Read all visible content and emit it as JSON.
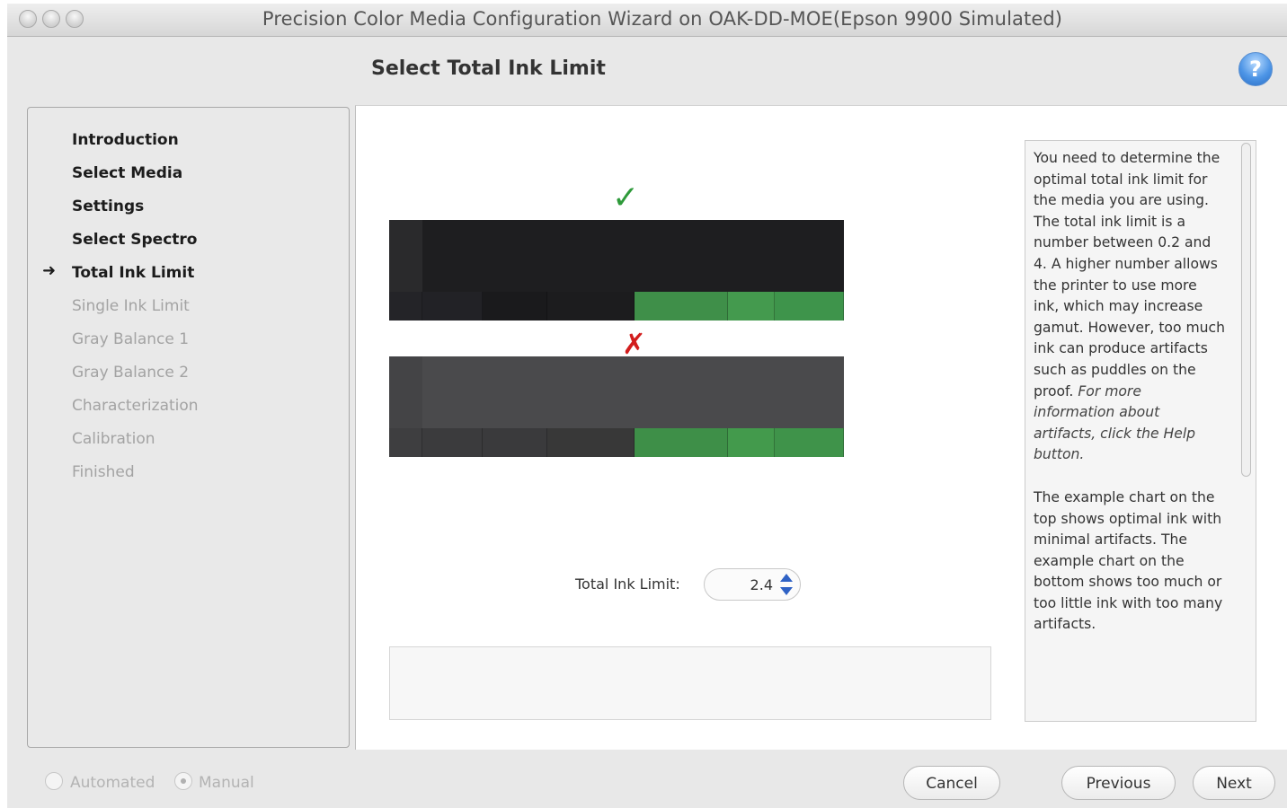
{
  "window": {
    "title": "Precision Color Media Configuration Wizard on OAK-DD-MOE(Epson 9900 Simulated)"
  },
  "header": {
    "title": "Select Total Ink Limit",
    "help_icon": "help-icon",
    "help_glyph": "?"
  },
  "sidebar": {
    "current_marker": "➜",
    "steps": [
      {
        "label": "Introduction",
        "state": "done"
      },
      {
        "label": "Select Media",
        "state": "done"
      },
      {
        "label": "Settings",
        "state": "done"
      },
      {
        "label": "Select Spectro",
        "state": "done"
      },
      {
        "label": "Total Ink Limit",
        "state": "current"
      },
      {
        "label": "Single Ink Limit",
        "state": "future"
      },
      {
        "label": "Gray Balance 1",
        "state": "future"
      },
      {
        "label": "Gray Balance 2",
        "state": "future"
      },
      {
        "label": "Characterization",
        "state": "future"
      },
      {
        "label": "Calibration",
        "state": "future"
      },
      {
        "label": "Finished",
        "state": "future"
      }
    ]
  },
  "examples": {
    "optimal_mark": "✓",
    "bad_mark": "✗",
    "optimal_patch_colors": [
      "#242428",
      "#222226",
      "#1a1a1c",
      "#1c1c1e",
      "#3f8f49",
      "#449a4e",
      "#3e944b"
    ],
    "bad_patch_colors": [
      "#3e3e40",
      "#3b3b3d",
      "#3a3a3c",
      "#383838",
      "#3e8f48",
      "#439a4c",
      "#3f934a"
    ]
  },
  "ink_limit": {
    "label": "Total Ink Limit:",
    "value": "2.4"
  },
  "description": {
    "paragraph1": "You need to determine the optimal total ink limit for the media you are using. The total ink limit is a number between 0.2 and 4. A higher number allows the printer to use more ink, which may increase gamut. However, too much ink can produce artifacts such as puddles on the proof.",
    "paragraph1_italic": "For more information about artifacts, click the Help button.",
    "paragraph2": "The example chart on the top shows optimal ink with minimal artifacts. The example chart on the bottom shows too much or too little ink with too many artifacts."
  },
  "mode": {
    "automated_label": "Automated",
    "manual_label": "Manual",
    "selected": "manual"
  },
  "buttons": {
    "cancel": "Cancel",
    "previous": "Previous",
    "next": "Next"
  }
}
